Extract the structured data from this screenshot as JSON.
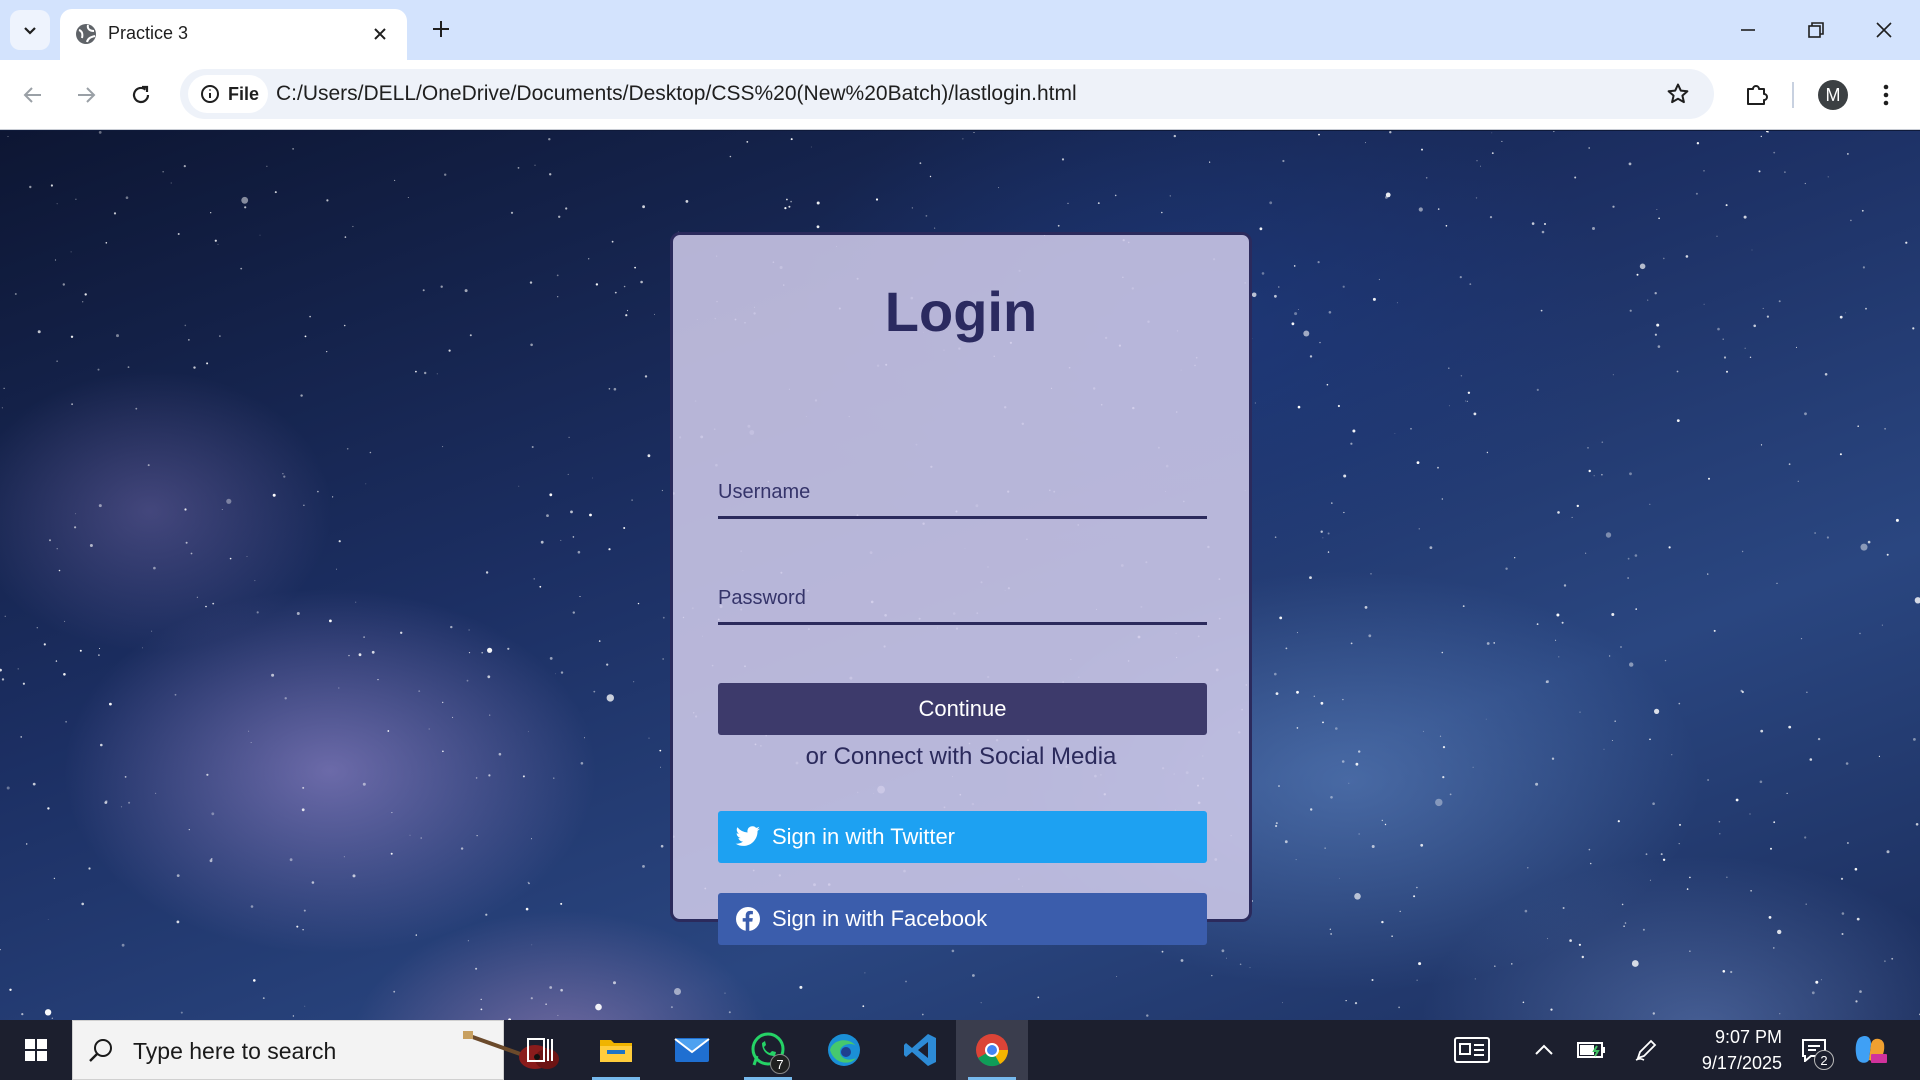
{
  "browser": {
    "tab_title": "Practice 3",
    "site_chip_label": "File",
    "url": "C:/Users/DELL/OneDrive/Documents/Desktop/CSS%20(New%20Batch)/lastlogin.html",
    "profile_initial": "M"
  },
  "login": {
    "title": "Login",
    "username_placeholder": "Username",
    "password_placeholder": "Password",
    "continue_label": "Continue",
    "social_text": "or Connect with Social Media",
    "twitter_label": "Sign in with Twitter",
    "facebook_label": "Sign in with Facebook",
    "colors": {
      "card_border": "#2b2a5c",
      "continue_bg": "#3d3a6b",
      "twitter_bg": "#1da1f2",
      "facebook_bg": "#3b5dac"
    }
  },
  "taskbar": {
    "search_placeholder": "Type here to search",
    "whatsapp_badge": "7",
    "time": "9:07 PM",
    "date": "9/17/2025",
    "notification_count": "2",
    "apps": [
      "task-view",
      "file-explorer",
      "mail",
      "whatsapp",
      "edge",
      "vscode",
      "chrome"
    ]
  }
}
